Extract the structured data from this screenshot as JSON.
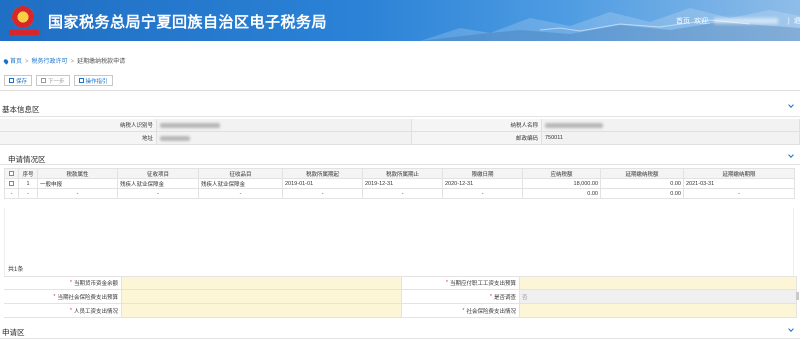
{
  "header": {
    "title": "国家税务总局宁夏回族自治区电子税务局",
    "home_link": "首页",
    "welcome": "欢迎,",
    "logout": "退出",
    "separator": "|"
  },
  "breadcrumb": {
    "home": "首页",
    "items": [
      "税务行政许可",
      "延期缴纳税款申请"
    ]
  },
  "toolbar": {
    "save": "保存",
    "next": "下一步",
    "guide": "操作指引"
  },
  "basic_info": {
    "title": "基本信息区",
    "taxpayer_id_label": "纳税人识别号",
    "taxpayer_name_label": "纳税人名称",
    "address_label": "地址",
    "postcode_label": "邮政编码",
    "postcode_value": "750011"
  },
  "application": {
    "title": "申请情况区",
    "columns": [
      "序号",
      "税款属性",
      "征收项目",
      "征收品目",
      "税款所属期起",
      "税款所属期止",
      "限缴日期",
      "应纳税额",
      "延期缴纳税额",
      "延期缴纳期限"
    ],
    "rows": [
      [
        "1",
        "一般申报",
        "残疾人就业保障金",
        "残疾人就业保障金",
        "2019-01-01",
        "2019-12-31",
        "2020-12-31",
        "18,000.00",
        "0.00",
        "2021-03-31"
      ],
      [
        "-",
        "-",
        "-",
        "-",
        "-",
        "-",
        "-",
        "0.00",
        "0.00",
        "-"
      ]
    ],
    "total": "共1条"
  },
  "form": {
    "row1_left": "当期货币资金余额",
    "row1_right": "当期应付职工工资支出预算",
    "row2_left": "当期社会保险费支出预算",
    "row2_right": "是否调查",
    "row2_right_value": "否",
    "row3_left": "人员工资支出情况",
    "row3_right": "社会保险费支出情况",
    "required_mark": "*"
  },
  "footer_section": {
    "title": "申请区"
  },
  "colors": {
    "header_blue": "#1f6fc4",
    "link_blue": "#1a73c9",
    "required_red": "#e0312f",
    "input_yellow": "#fdf6d6"
  }
}
